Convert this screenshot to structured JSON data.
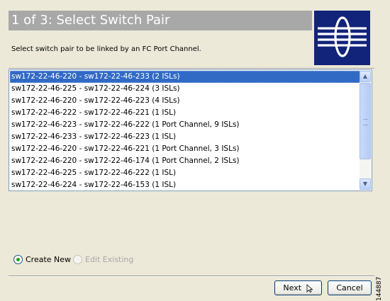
{
  "header": {
    "title": "1 of 3: Select Switch Pair",
    "subtitle": "Select switch pair to be linked by an FC Port Channel."
  },
  "switch_pairs": {
    "items": [
      "sw172-22-46-220 - sw172-22-46-233 (2 ISLs)",
      "sw172-22-46-225 - sw172-22-46-224 (3 ISLs)",
      "sw172-22-46-220 - sw172-22-46-223 (4 ISLs)",
      "sw172-22-46-222 - sw172-22-46-221 (1 ISL)",
      "sw172-22-46-223 - sw172-22-46-222 (1 Port Channel, 9 ISLs)",
      "sw172-22-46-233 - sw172-22-46-223 (1 ISL)",
      "sw172-22-46-220 - sw172-22-46-221 (1 Port Channel, 3 ISLs)",
      "sw172-22-46-220 - sw172-22-46-174 (1 Port Channel, 2 ISLs)",
      "sw172-22-46-225 - sw172-22-46-222 (1 ISL)",
      "sw172-22-46-224 - sw172-22-46-153 (1 ISL)"
    ],
    "selected_index": 0
  },
  "options": {
    "create_new": "Create New",
    "edit_existing": "Edit Existing",
    "selected": "create_new"
  },
  "buttons": {
    "next": "Next",
    "cancel": "Cancel"
  },
  "figure_id": "144887",
  "colors": {
    "selection": "#316ac5",
    "header_bar": "#a8a8a8",
    "logo_bg": "#12237a"
  },
  "icons": {
    "logo": "cisco-bridge-logo-icon",
    "next": "mouse-pointer-icon"
  }
}
